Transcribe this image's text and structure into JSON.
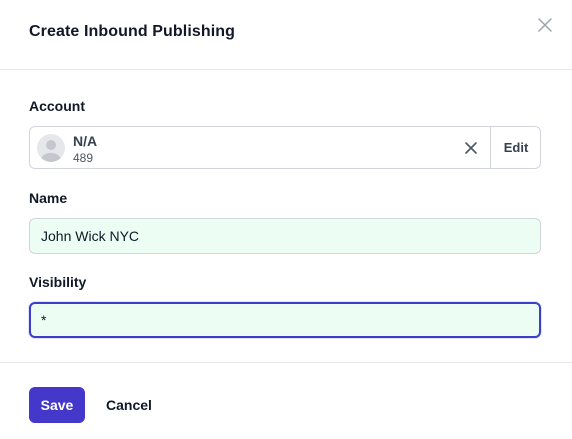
{
  "dialog": {
    "title": "Create Inbound Publishing"
  },
  "account": {
    "label": "Account",
    "name": "N/A",
    "id": "489",
    "edit_label": "Edit"
  },
  "name_field": {
    "label": "Name",
    "value": "John Wick NYC"
  },
  "visibility_field": {
    "label": "Visibility",
    "value": "*"
  },
  "footer": {
    "save_label": "Save",
    "cancel_label": "Cancel"
  },
  "colors": {
    "primary": "#4338ca",
    "input_bg": "#ecfdf3",
    "focus_border": "#3b3fc8"
  }
}
